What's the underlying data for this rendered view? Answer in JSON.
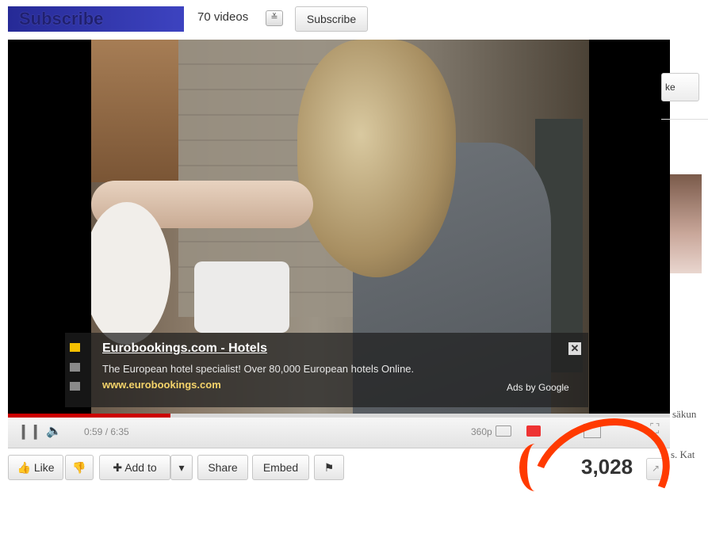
{
  "channel": {
    "subscribe_banner": "Subscribe",
    "videos_count": "70 videos",
    "subscribe_button": "Subscribe"
  },
  "ad": {
    "title": "Eurobookings.com - Hotels",
    "description": "The European hotel specialist! Over 80,000 European hotels Online.",
    "url": "www.eurobookings.com",
    "attribution": "Ads by Google",
    "close_symbol": "✕",
    "indicator_colors": [
      "#f5c000",
      "#8a8a8a",
      "#8a8a8a"
    ]
  },
  "player": {
    "time": "0:59 / 6:35",
    "quality": "360p",
    "progress_fraction": 0.246
  },
  "actions": {
    "like": "Like",
    "add_to": "Add to",
    "share": "Share",
    "embed": "Embed",
    "views": "3,028"
  },
  "sidebar": {
    "button_fragment": "ke",
    "text_fragment_1": "säkun",
    "text_fragment_2": "s. Kat"
  },
  "colors": {
    "accent_red": "#cc0000",
    "annotation": "#ff3a00",
    "ad_url": "#f5d36a"
  }
}
